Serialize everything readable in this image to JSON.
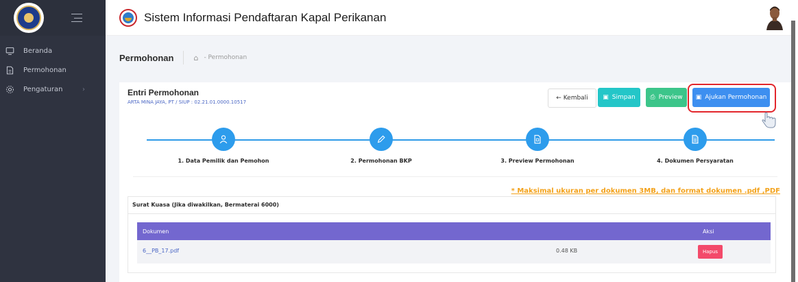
{
  "sidebar": {
    "items": [
      {
        "label": "Beranda",
        "icon": "monitor-icon"
      },
      {
        "label": "Permohonan",
        "icon": "document-icon"
      },
      {
        "label": "Pengaturan",
        "icon": "gear-icon"
      }
    ]
  },
  "header": {
    "app_title": "Sistem Informasi Pendaftaran Kapal Perikanan"
  },
  "breadcrumb": {
    "page_title": "Permohonan",
    "current": "- Permohonan"
  },
  "form": {
    "title": "Entri Permohonan",
    "subtitle": "ARTA MINA JAYA, PT / SIUP : 02.21.01.0000.10517",
    "buttons": {
      "kembali": "← Kembali",
      "simpan": "Simpan",
      "preview": "Preview",
      "ajukan": "Ajukan Permohonan"
    }
  },
  "steps": [
    {
      "label": "1. Data Pemilik dan Pemohon",
      "icon": "user-icon"
    },
    {
      "label": "2. Permohonan BKP",
      "icon": "pencil-icon"
    },
    {
      "label": "3. Preview Permohonan",
      "icon": "file-icon"
    },
    {
      "label": "4. Dokumen Persyaratan",
      "icon": "file-text-icon"
    }
  ],
  "note": "* Maksimal ukuran per dokumen 3MB, dan format dokumen .pdf ,PDF",
  "document_section": {
    "title": "Surat Kuasa (Jika diwakilkan, Bermaterai 6000)",
    "columns": {
      "dokumen": "Dokumen",
      "aksi": "Aksi"
    },
    "rows": [
      {
        "file": "6__PB_17.pdf",
        "size": "0.48 KB",
        "action": "Hapus"
      }
    ]
  },
  "colors": {
    "sidebar_bg": "#2f3340",
    "primary_step": "#2d9cec",
    "table_header": "#7367cf",
    "simpan": "#24c6c8",
    "preview": "#3cc58a",
    "ajukan": "#3d8ff0",
    "hapus": "#f34a6a",
    "note": "#f3a21b",
    "highlight": "#e2252b"
  }
}
